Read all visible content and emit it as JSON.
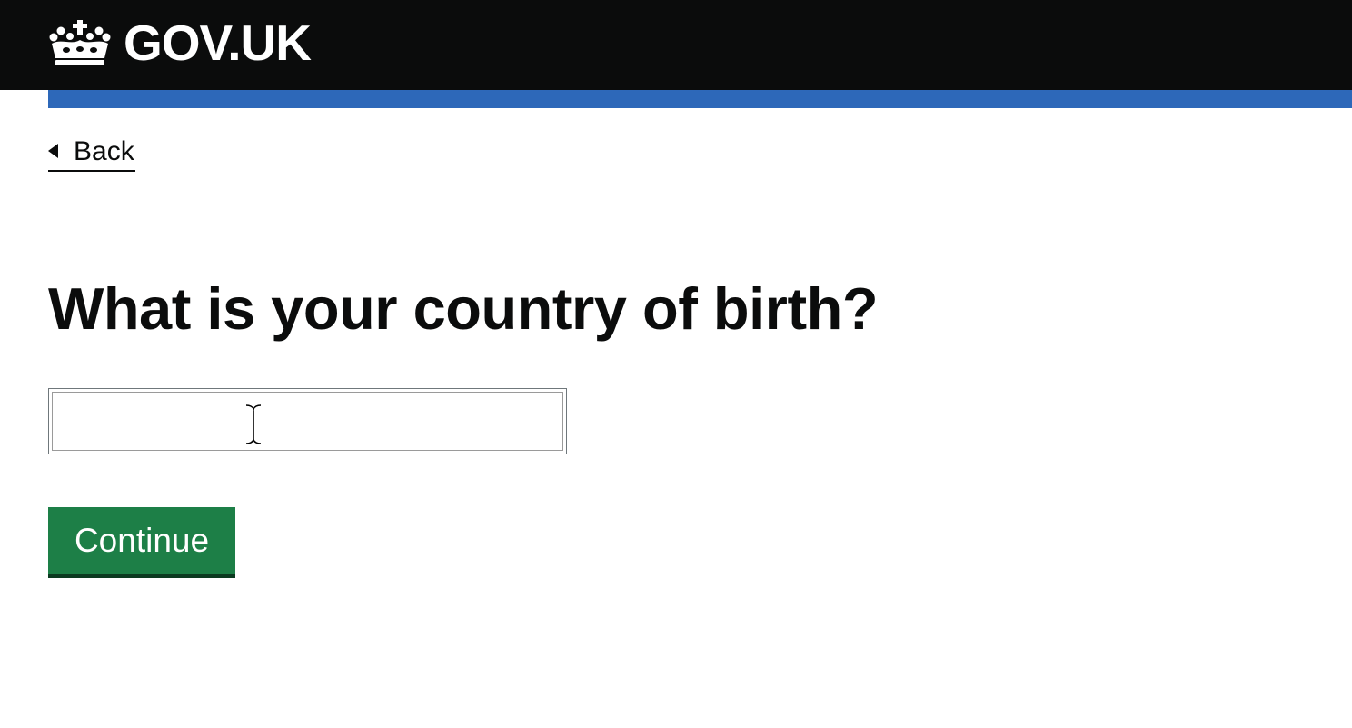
{
  "header": {
    "logo_text": "GOV.UK",
    "logo_icon": "crown-icon",
    "background_color": "#0b0c0c",
    "accent_bar_color": "#2d68b9"
  },
  "navigation": {
    "back_label": "Back",
    "back_icon": "triangle-left-icon"
  },
  "main": {
    "question": "What is your country of birth?",
    "country_input": {
      "value": "",
      "placeholder": ""
    },
    "cursor_icon": "text-cursor-icon",
    "continue_label": "Continue",
    "button_color": "#1d7f47"
  }
}
